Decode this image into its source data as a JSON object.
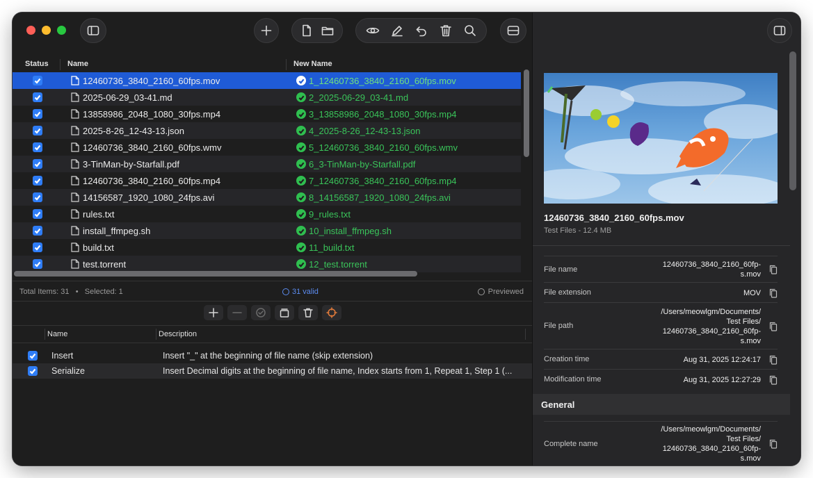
{
  "toolbar": {
    "left_icon": "sidebar-icon",
    "add_icon": "plus-icon",
    "file_icons": [
      "document-icon",
      "folder-icon"
    ],
    "action_icons": [
      "eye-icon",
      "pencil-icon",
      "undo-icon",
      "trash-icon",
      "search-icon"
    ],
    "layout_icon": "split-icon",
    "right_icon": "inspector-icon"
  },
  "table": {
    "headers": {
      "status": "Status",
      "name": "Name",
      "new_name": "New Name"
    },
    "rows": [
      {
        "name": "12460736_3840_2160_60fps.mov",
        "new_name": "1_12460736_3840_2160_60fps.mov",
        "selected": true
      },
      {
        "name": "2025-06-29_03-41.md",
        "new_name": "2_2025-06-29_03-41.md"
      },
      {
        "name": "13858986_2048_1080_30fps.mp4",
        "new_name": "3_13858986_2048_1080_30fps.mp4"
      },
      {
        "name": "2025-8-26_12-43-13.json",
        "new_name": "4_2025-8-26_12-43-13.json"
      },
      {
        "name": "12460736_3840_2160_60fps.wmv",
        "new_name": "5_12460736_3840_2160_60fps.wmv"
      },
      {
        "name": "3-TinMan-by-Starfall.pdf",
        "new_name": "6_3-TinMan-by-Starfall.pdf"
      },
      {
        "name": "12460736_3840_2160_60fps.mp4",
        "new_name": "7_12460736_3840_2160_60fps.mp4"
      },
      {
        "name": "14156587_1920_1080_24fps.avi",
        "new_name": "8_14156587_1920_1080_24fps.avi"
      },
      {
        "name": "rules.txt",
        "new_name": "9_rules.txt"
      },
      {
        "name": "install_ffmpeg.sh",
        "new_name": "10_install_ffmpeg.sh"
      },
      {
        "name": "build.txt",
        "new_name": "11_build.txt"
      },
      {
        "name": "test.torrent",
        "new_name": "12_test.torrent"
      }
    ]
  },
  "status": {
    "total": "Total Items: 31",
    "separator": "•",
    "selected": "Selected: 1",
    "valid": "31 valid",
    "previewed": "Previewed"
  },
  "rules": {
    "headers": {
      "name": "Name",
      "description": "Description"
    },
    "items": [
      {
        "name": "Insert",
        "description": "Insert \"_\" at the beginning of file name (skip extension)"
      },
      {
        "name": "Serialize",
        "description": "Insert Decimal digits at the beginning of file name, Index starts from 1, Repeat 1, Step 1 (..."
      }
    ]
  },
  "inspector": {
    "title": "12460736_3840_2160_60fps.mov",
    "subtitle": "Test Files  -  12.4 MB",
    "properties": [
      {
        "key": "File name",
        "value": [
          "12460736_3840_2160_60fp-",
          "s.mov"
        ]
      },
      {
        "key": "File extension",
        "value": [
          "MOV"
        ]
      },
      {
        "key": "File path",
        "value": [
          "/Users/meowlgm/Documents/",
          "Test Files/",
          "12460736_3840_2160_60fp-",
          "s.mov"
        ]
      },
      {
        "key": "Creation time",
        "value": [
          "Aug 31, 2025 12:24:17"
        ]
      },
      {
        "key": "Modification time",
        "value": [
          "Aug 31, 2025 12:27:29"
        ]
      }
    ],
    "section": "General",
    "general": [
      {
        "key": "Complete name",
        "value": [
          "/Users/meowlgm/Documents/",
          "Test Files/",
          "12460736_3840_2160_60fp-",
          "s.mov"
        ]
      }
    ]
  }
}
